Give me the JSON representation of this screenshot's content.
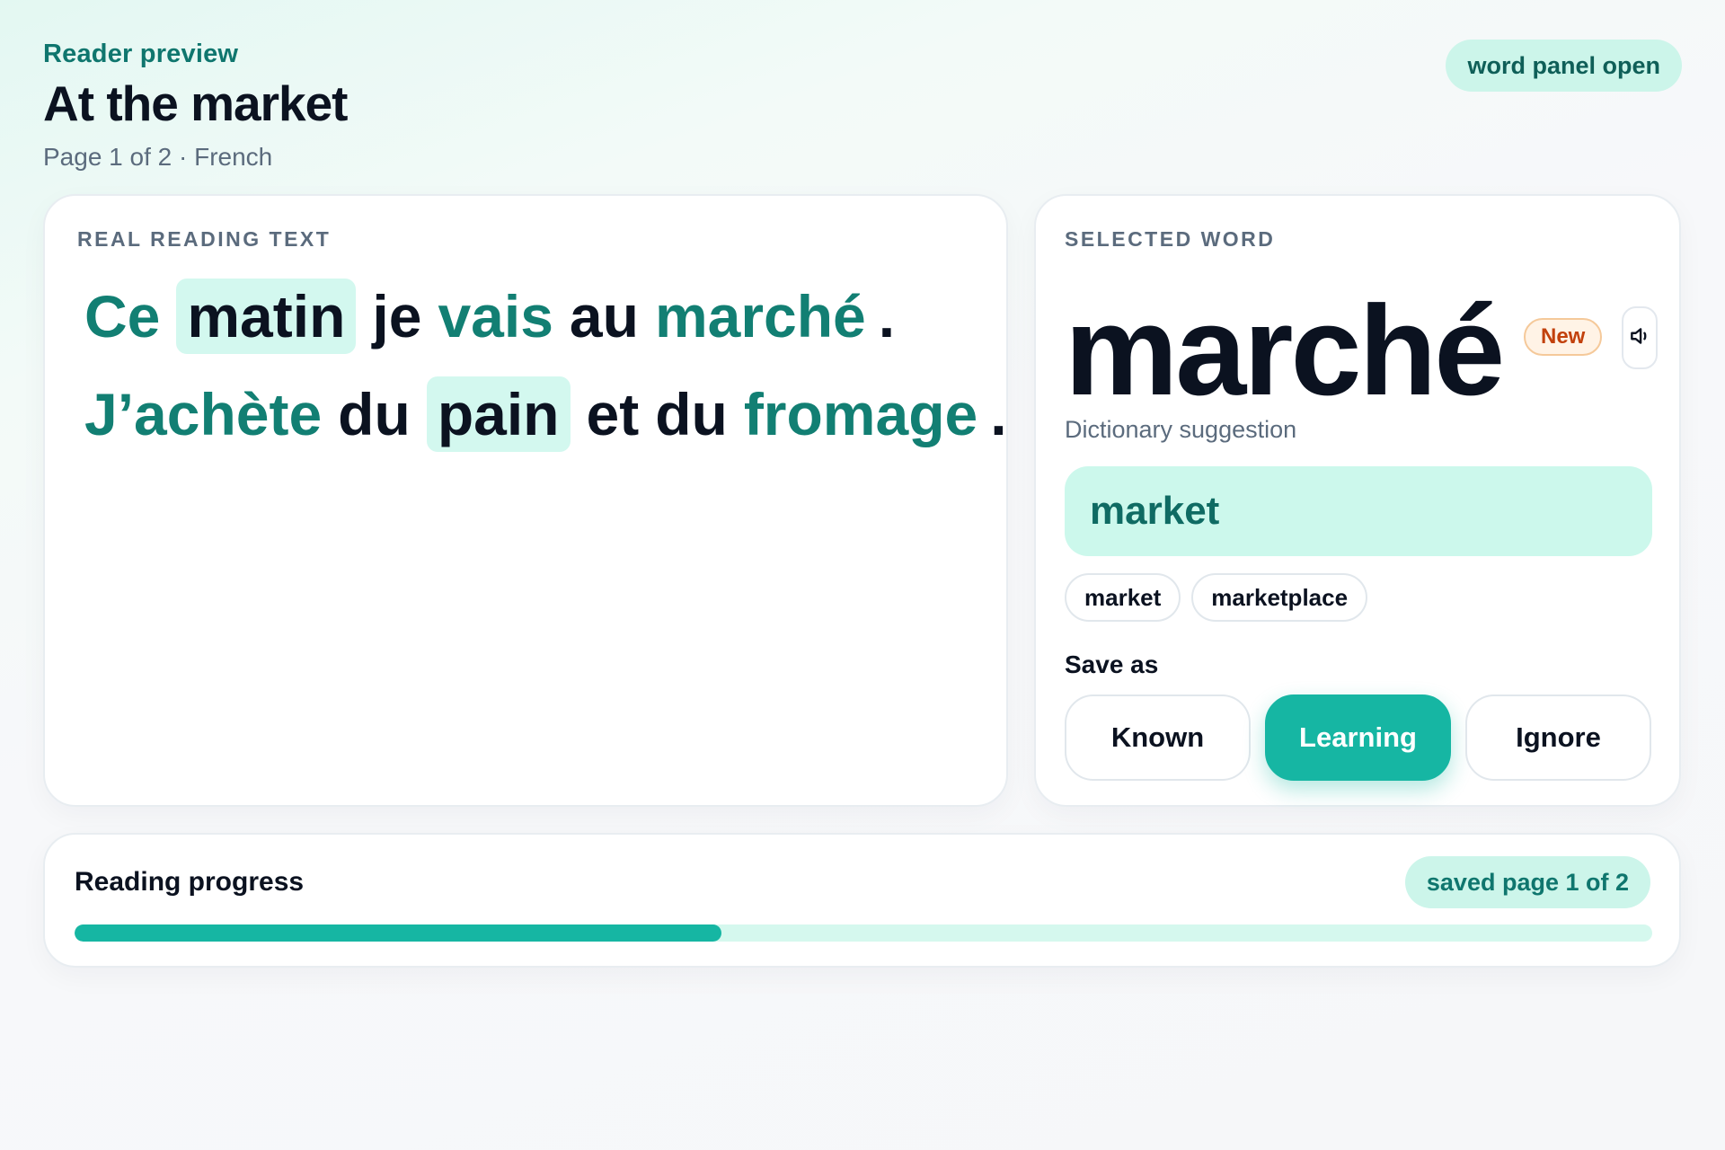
{
  "header": {
    "eyebrow": "Reader preview",
    "title": "At the market",
    "subtitle": "Page 1 of 2 · French"
  },
  "status_pill": "word panel open",
  "reading": {
    "label": "REAL READING TEXT",
    "lines": [
      [
        {
          "text": "Ce",
          "state": "learning"
        },
        {
          "text": "matin",
          "state": "highlight"
        },
        {
          "text": "je",
          "state": "known"
        },
        {
          "text": "vais",
          "state": "learning"
        },
        {
          "text": "au",
          "state": "known"
        },
        {
          "text": "marché",
          "state": "learning"
        },
        {
          "text": ".",
          "state": "punct"
        }
      ],
      [
        {
          "text": "J’achète",
          "state": "learning"
        },
        {
          "text": "du",
          "state": "known"
        },
        {
          "text": "pain",
          "state": "highlight"
        },
        {
          "text": "et",
          "state": "known"
        },
        {
          "text": "du",
          "state": "known"
        },
        {
          "text": "fromage",
          "state": "learning"
        },
        {
          "text": ".",
          "state": "punct"
        }
      ]
    ]
  },
  "word_panel": {
    "label": "SELECTED WORD",
    "word": "marché",
    "badge": "New",
    "speaker_icon": "speaker-icon",
    "dictionary_label": "Dictionary suggestion",
    "translation": "market",
    "alternatives": [
      "market",
      "marketplace"
    ],
    "save_label": "Save as",
    "save_options": [
      {
        "label": "Known",
        "active": false
      },
      {
        "label": "Learning",
        "active": true
      },
      {
        "label": "Ignore",
        "active": false
      }
    ]
  },
  "progress": {
    "title": "Reading progress",
    "pill": "saved page 1 of 2",
    "fraction": 0.41
  },
  "colors": {
    "accent": "#16b6a3",
    "learning_word": "#127f73",
    "highlight_bg": "#d3f8ef",
    "badge_orange": "#c2410c"
  }
}
